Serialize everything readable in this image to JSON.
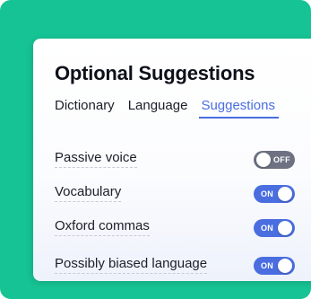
{
  "panel": {
    "title": "Optional Suggestions"
  },
  "tabs": [
    {
      "label": "Dictionary",
      "active": false
    },
    {
      "label": "Language",
      "active": false
    },
    {
      "label": "Suggestions",
      "active": true
    }
  ],
  "settings": [
    {
      "label": "Passive voice",
      "state": "OFF"
    },
    {
      "label": "Vocabulary",
      "state": "ON"
    },
    {
      "label": "Oxford commas",
      "state": "ON"
    },
    {
      "label": "Possibly biased language",
      "state": "ON"
    }
  ],
  "colors": {
    "backdrop": "#16c394",
    "accent": "#4a6ee0",
    "toggle_off": "#6d7182",
    "text": "#1c1e29"
  }
}
